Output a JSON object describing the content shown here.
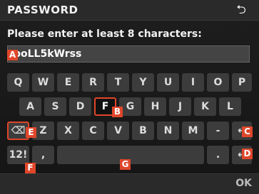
{
  "header": {
    "title": "PASSWORD",
    "back_icon": "return-arrow-icon"
  },
  "instruction": "Please enter at least 8 characters:",
  "password_input": {
    "value": "poLL5kWrss"
  },
  "keyboard": {
    "row1": [
      "Q",
      "W",
      "E",
      "R",
      "T",
      "Y",
      "U",
      "I",
      "O",
      "P"
    ],
    "row2": [
      "A",
      "S",
      "D",
      "F",
      "G",
      "H",
      "J",
      "K",
      "L"
    ],
    "row3": [
      "Z",
      "X",
      "C",
      "V",
      "B",
      "N",
      "M",
      "-"
    ],
    "backspace_icon": "backspace-icon",
    "enter_icon": "enter-arrow-icon",
    "mode_key": "12!",
    "comma_key": ",",
    "period_key": ".",
    "selected_key": "F"
  },
  "footer": {
    "ok_label": "OK"
  },
  "callouts": {
    "A": "A",
    "B": "B",
    "C": "C",
    "D": "D",
    "E": "E",
    "F": "F",
    "G": "G"
  },
  "colors": {
    "accent": "#e0462a",
    "key": "#3c3c3c",
    "background": "#1a1a1a"
  }
}
